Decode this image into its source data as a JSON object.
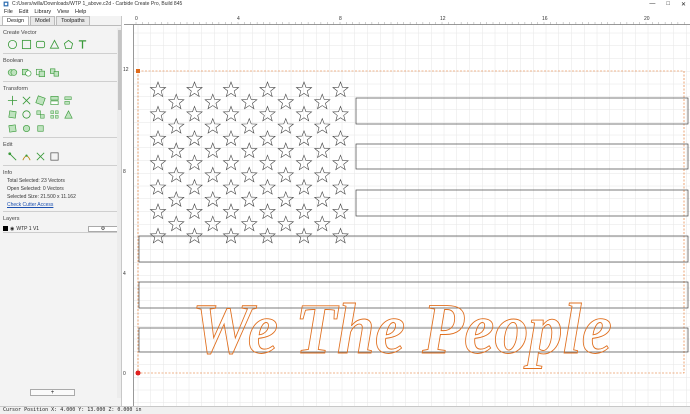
{
  "window": {
    "title": "C:/Users/willa/Downloads/WTP 1_above.c2d - Carbide Create Pro, Build 845",
    "controls": [
      "—",
      "□",
      "✕"
    ]
  },
  "menu": [
    "File",
    "Edit",
    "Library",
    "View",
    "Help"
  ],
  "tabs": [
    "Design",
    "Model",
    "Toolpaths"
  ],
  "sections": {
    "create_vector": "Create Vector",
    "boolean": "Boolean",
    "transform": "Transform",
    "edit": "Edit",
    "info": "Info",
    "layers": "Layers"
  },
  "info": {
    "total_selected": "Total Selected:  23 Vectors",
    "open_selected": "Open Selected:  0 Vectors",
    "selected_size": "Selected Size:  21.500 x 11.162",
    "check_link": "Check Cutter Access"
  },
  "layer": {
    "name": "WTP 1 V1",
    "gear": "⚙"
  },
  "add_layer": "+",
  "ruler": {
    "top_labels": [
      "0",
      "4",
      "8",
      "12",
      "16",
      "20"
    ],
    "left_labels": [
      "12",
      "8",
      "4",
      "0"
    ]
  },
  "canvas": {
    "text": "We The People",
    "text_color": "#e07020",
    "vector_color": "#444444",
    "selection_color": "#e06a1a"
  },
  "status": "Cursor Position X: 4.000 Y: 13.000 Z: 0.000 in",
  "icons": {
    "create_vector": [
      "circle-icon",
      "rectangle-icon",
      "rounded-rect-icon",
      "polygon-icon",
      "polyline-icon",
      "text-icon"
    ],
    "boolean": [
      "union-icon",
      "subtract-icon",
      "intersect-icon",
      "weld-icon"
    ],
    "transform": [
      "move-icon",
      "scale-icon",
      "rotate-icon",
      "mirror-icon",
      "align-icon"
    ],
    "edit": [
      "node-edit-icon",
      "trim-icon",
      "scissors-icon",
      "offset-icon"
    ]
  }
}
